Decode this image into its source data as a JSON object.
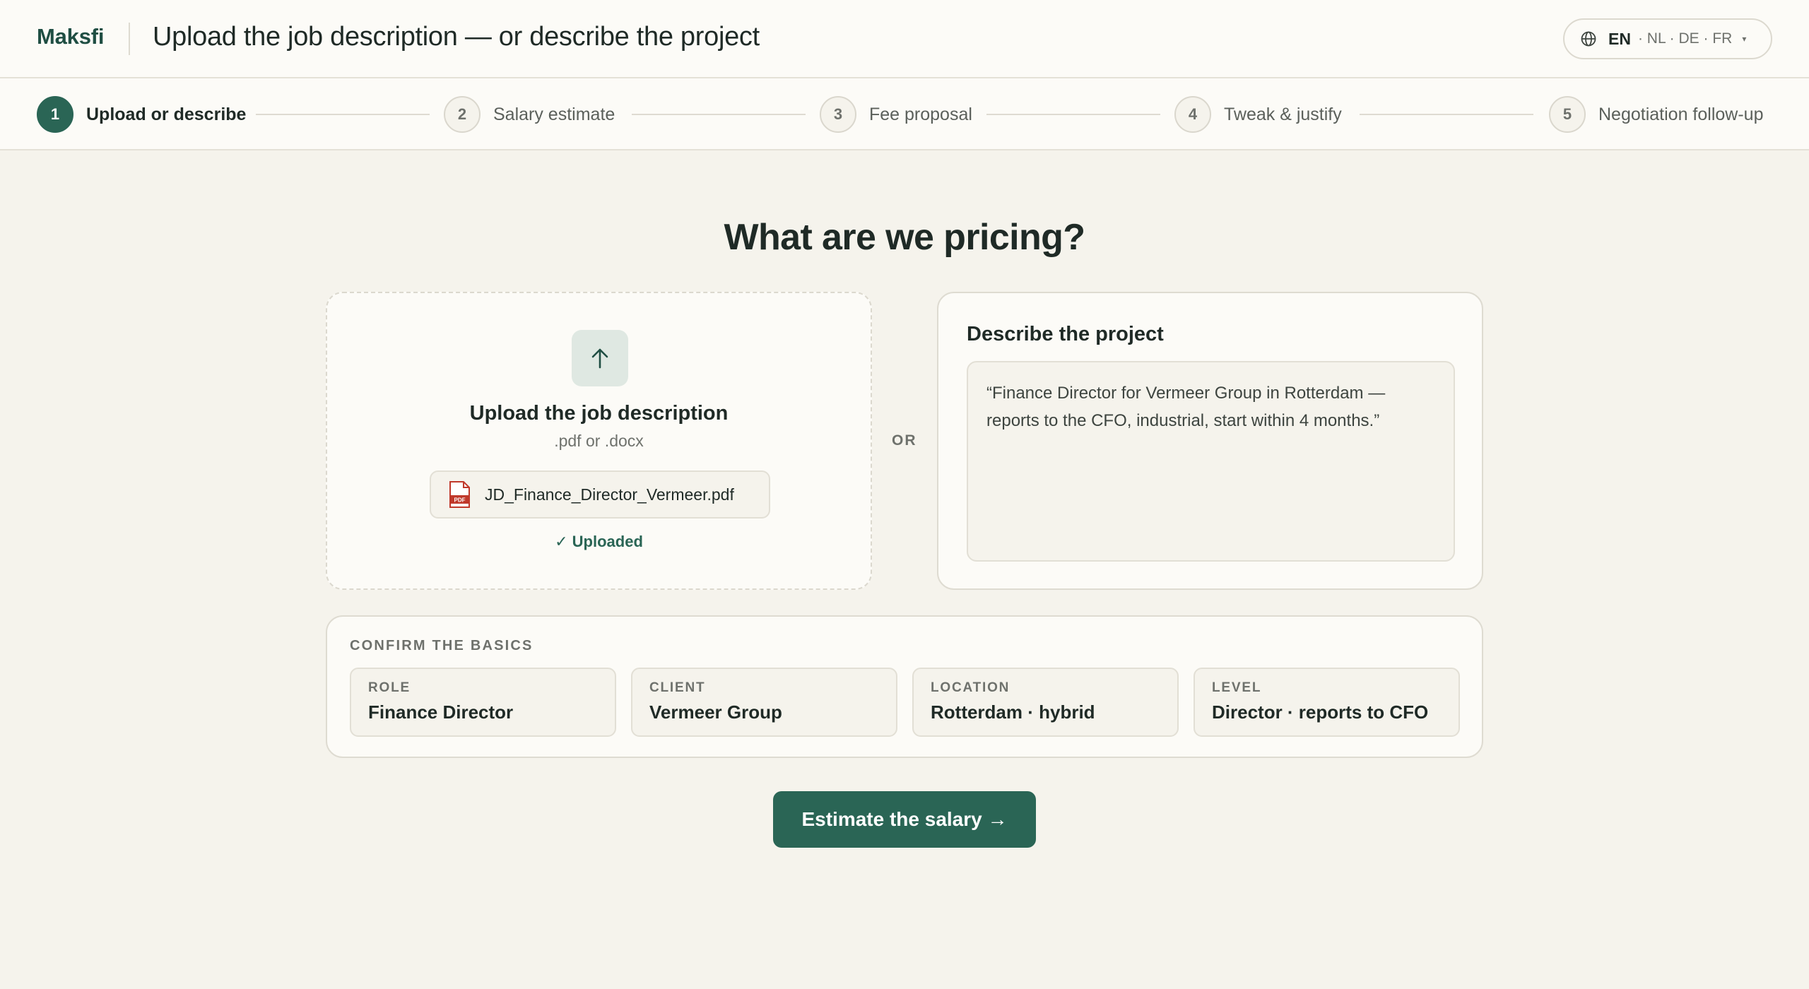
{
  "header": {
    "logo": "Maksfi",
    "title": "Upload the job description — or describe the project",
    "language": {
      "active": "EN",
      "others": "· NL · DE · FR",
      "caret": "▾"
    }
  },
  "stepper": {
    "steps": [
      {
        "number": "1",
        "label": "Upload or describe",
        "active": true
      },
      {
        "number": "2",
        "label": "Salary estimate",
        "active": false
      },
      {
        "number": "3",
        "label": "Fee proposal",
        "active": false
      },
      {
        "number": "4",
        "label": "Tweak & justify",
        "active": false
      },
      {
        "number": "5",
        "label": "Negotiation follow-up",
        "active": false
      }
    ]
  },
  "main": {
    "heading": "What are we pricing?",
    "upload": {
      "title": "Upload the job description",
      "formats": ".pdf or .docx",
      "file_name": "JD_Finance_Director_Vermeer.pdf",
      "file_icon_text": "PDF",
      "status": "✓ Uploaded"
    },
    "or_label": "OR",
    "describe": {
      "title": "Describe the project",
      "text": "“Finance Director for Vermeer Group in Rotterdam — reports to the CFO, industrial, start within 4 months.”"
    },
    "basics": {
      "title": "CONFIRM THE BASICS",
      "fields": [
        {
          "label": "ROLE",
          "value": "Finance Director"
        },
        {
          "label": "CLIENT",
          "value": "Vermeer Group"
        },
        {
          "label": "LOCATION",
          "value": "Rotterdam · hybrid"
        },
        {
          "label": "LEVEL",
          "value": "Director · reports to CFO"
        }
      ]
    },
    "cta": "Estimate the salary →"
  },
  "colors": {
    "accent": "#2a6555",
    "background": "#f5f3ec",
    "surface": "#fcfbf7",
    "pdf_red": "#c0392b"
  },
  "icons": {
    "language": "globe-icon",
    "upload": "arrow-up-icon",
    "file": "pdf-file-icon"
  }
}
